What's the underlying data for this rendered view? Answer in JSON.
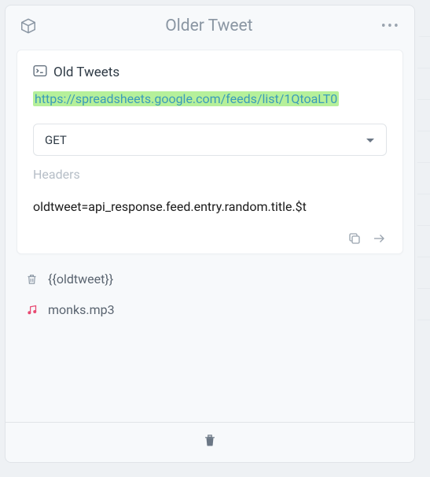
{
  "header": {
    "title": "Older Tweet"
  },
  "card": {
    "title": "Old Tweets",
    "url": "https://spreadsheets.google.com/feeds/list/1QtoaLT0",
    "method": "GET",
    "headers_placeholder": "Headers",
    "assignment": "oldtweet=api_response.feed.entry.random.title.$t"
  },
  "rows": {
    "tweet_var": "{{oldtweet}}",
    "audio_file": "monks.mp3"
  }
}
